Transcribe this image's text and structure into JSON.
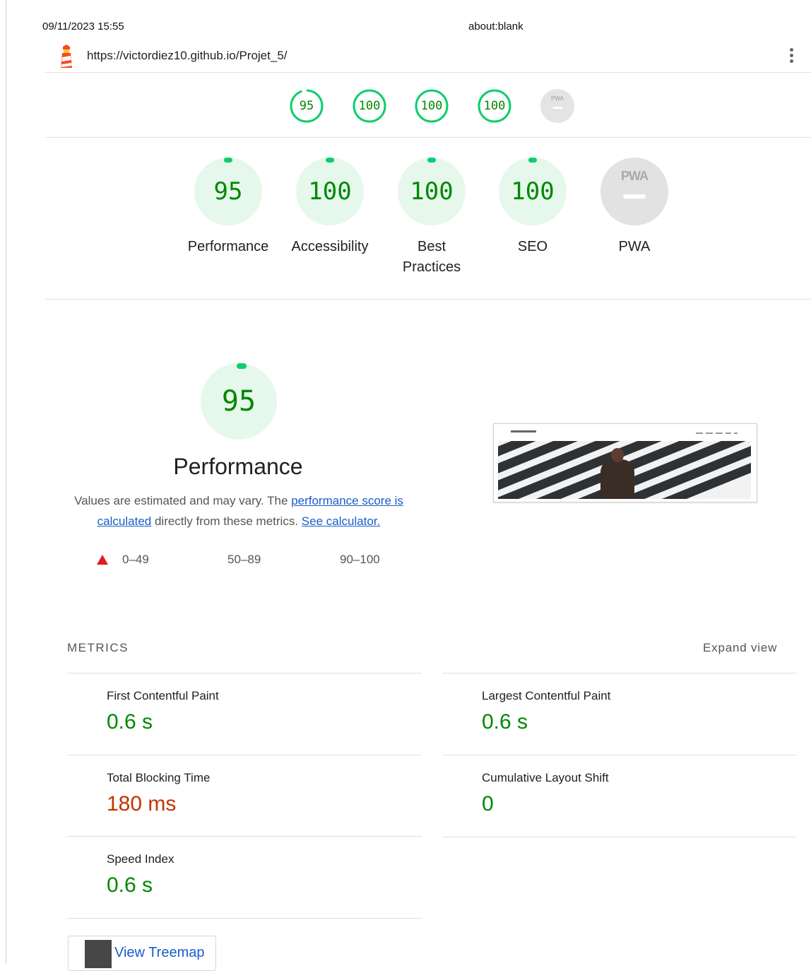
{
  "print_header": {
    "date": "09/11/2023 15:55",
    "title": "about:blank"
  },
  "topbar": {
    "url": "https://victordiez10.github.io/Projet_5/",
    "menu_icon": "kebab-menu-icon",
    "logo_icon": "lighthouse-icon"
  },
  "sticky_scores": [
    {
      "value": "95",
      "score": 0.95
    },
    {
      "value": "100",
      "score": 1.0
    },
    {
      "value": "100",
      "score": 1.0
    },
    {
      "value": "100",
      "score": 1.0
    },
    {
      "value": "PWA",
      "score": null
    }
  ],
  "categories": [
    {
      "score": "95",
      "label": "Performance"
    },
    {
      "score": "100",
      "label": "Accessibility"
    },
    {
      "score": "100",
      "label": "Best Practices"
    },
    {
      "score": "100",
      "label": "SEO"
    },
    {
      "score": "PWA",
      "label": "PWA"
    }
  ],
  "performance": {
    "score": "95",
    "title": "Performance",
    "desc_part1": "Values are estimated and may vary. The ",
    "link_score": "performance score is calculated",
    "desc_part2": " directly from these metrics. ",
    "link_calculator": "See calculator.",
    "legend": {
      "fail": "0–49",
      "average": "50–89",
      "pass": "90–100"
    }
  },
  "metrics": {
    "header": "METRICS",
    "expand": "Expand view",
    "items": [
      {
        "title": "First Contentful Paint",
        "value": "0.6 s",
        "status": "pass"
      },
      {
        "title": "Largest Contentful Paint",
        "value": "0.6 s",
        "status": "pass"
      },
      {
        "title": "Total Blocking Time",
        "value": "180 ms",
        "status": "average"
      },
      {
        "title": "Cumulative Layout Shift",
        "value": "0",
        "status": "pass"
      },
      {
        "title": "Speed Index",
        "value": "0.6 s",
        "status": "pass"
      }
    ]
  },
  "treemap_button": {
    "label": "View Treemap"
  },
  "colors": {
    "pass": "#008800",
    "pass_ring": "#0cce6b",
    "pass_bg": "#e6f8ec",
    "average": "#c33300",
    "fail": "#e51b1b",
    "link": "#1a5ec9"
  }
}
